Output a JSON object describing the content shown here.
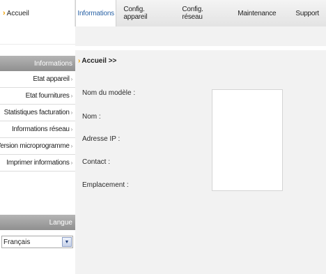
{
  "top": {
    "breadcrumb": "Accueil"
  },
  "tabs": [
    {
      "label": "Informations",
      "active": true
    },
    {
      "label": "Config. appareil"
    },
    {
      "label": "Config. réseau"
    },
    {
      "label": "Maintenance"
    },
    {
      "label": "Support"
    }
  ],
  "sidebar": {
    "header": "Informations",
    "items": [
      {
        "label": "Etat appareil"
      },
      {
        "label": "Etat fournitures"
      },
      {
        "label": "Statistiques facturation"
      },
      {
        "label": "Informations réseau"
      },
      {
        "label": "Version microprogramme"
      },
      {
        "label": "Imprimer informations"
      }
    ],
    "arrow": "›"
  },
  "language": {
    "header": "Langue",
    "selected": "Français"
  },
  "main": {
    "title": "Accueil >>",
    "fields": [
      {
        "label": "Nom du modèle :"
      },
      {
        "label": "Nom :"
      },
      {
        "label": "Adresse IP :"
      },
      {
        "label": "Contact :"
      },
      {
        "label": "Emplacement :"
      }
    ]
  },
  "colors": {
    "accent": "#f0a000",
    "active_tab": "#2a63a6",
    "sidebar_header": "#9e9e9e",
    "main_bg": "#f2f2f2"
  },
  "icons": {
    "breadcrumb": "chevron-right-icon",
    "dropdown": "chevron-down-icon"
  }
}
